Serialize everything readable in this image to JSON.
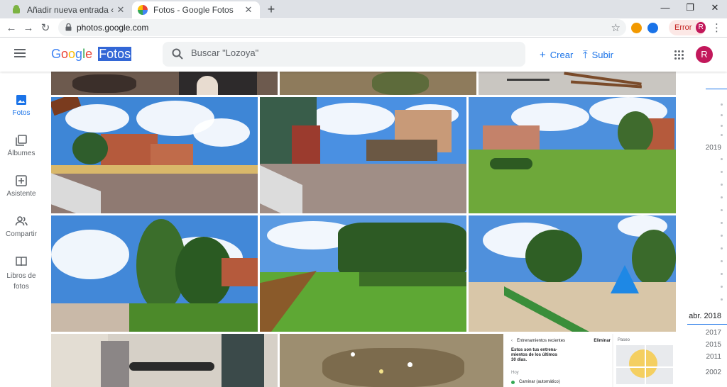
{
  "browser": {
    "tabs": [
      {
        "title": "Añadir nueva entrada ‹ Todo And",
        "active": false
      },
      {
        "title": "Fotos - Google Fotos",
        "active": true
      }
    ],
    "new_tab": "+",
    "window": {
      "minimize": "—",
      "maximize": "❐",
      "close": "✕"
    },
    "url": "photos.google.com",
    "error_label": "Error",
    "profile_initial": "R",
    "ext_colors": [
      "#f29900",
      "#1a73e8"
    ]
  },
  "app": {
    "logo_google": [
      "G",
      "o",
      "o",
      "g",
      "l",
      "e"
    ],
    "logo_product": "Fotos",
    "search_placeholder": "Buscar \"Lozoya\"",
    "create_label": "Crear",
    "upload_label": "Subir",
    "avatar_initial": "R",
    "accent": "#1a73e8"
  },
  "nav": [
    {
      "label": "Fotos",
      "icon": "photo-icon",
      "active": true
    },
    {
      "label": "Álbumes",
      "icon": "album-icon",
      "active": false
    },
    {
      "label": "Asistente",
      "icon": "assistant-icon",
      "active": false
    },
    {
      "label": "Compartir",
      "icon": "sharing-icon",
      "active": false
    },
    {
      "label": "Libros de fotos",
      "icon": "photobook-icon",
      "active": false
    }
  ],
  "timeline": {
    "years_top": [
      "2019"
    ],
    "current": "abr. 2018",
    "years_bottom": [
      "2017",
      "2015",
      "2011",
      "2002"
    ]
  },
  "fitness_card": {
    "header": "Entrenamientos recientes",
    "action": "Eliminar",
    "body": "Estos son tus entrena-mientos de los últimos 30 días.",
    "day": "Hoy",
    "entry": "Caminar (automático)",
    "map_label": "Paseo"
  },
  "photos": [
    {
      "scene": "market-crop-top"
    },
    {
      "scene": "dry-grass-top"
    },
    {
      "scene": "wood-sticks-top"
    },
    {
      "scene": "medieval-fair-street"
    },
    {
      "scene": "market-stalls"
    },
    {
      "scene": "park-lawn-buildings"
    },
    {
      "scene": "park-tree-building"
    },
    {
      "scene": "park-hedge-lawn"
    },
    {
      "scene": "playground"
    },
    {
      "scene": "indoor-equipment"
    },
    {
      "scene": "wildflowers"
    },
    {
      "scene": "fitness-screenshot"
    }
  ]
}
